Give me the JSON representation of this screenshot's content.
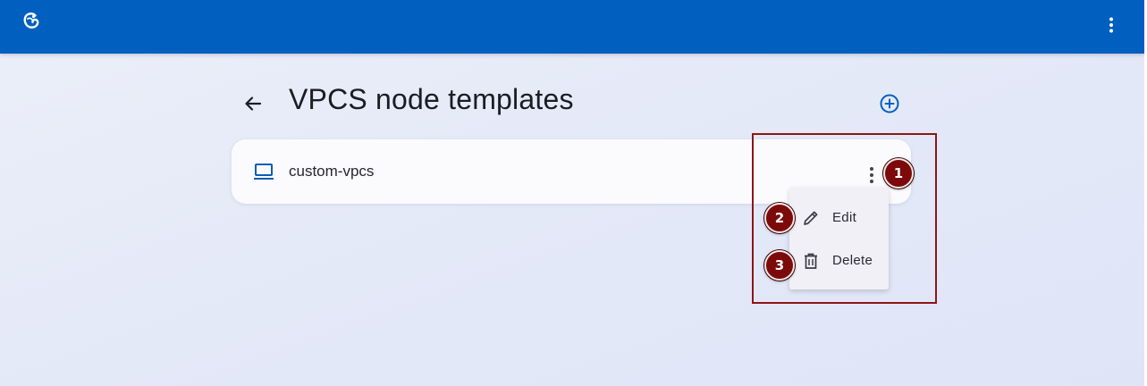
{
  "topbar": {
    "logo_icon": "gns3-logo-icon",
    "menu_icon": "more-vert-icon",
    "color": "#005fbf"
  },
  "header": {
    "back_icon": "arrow-back-icon",
    "title": "VPCS node templates",
    "add_icon": "add-circle-icon"
  },
  "templates": [
    {
      "icon": "computer-icon",
      "name": "custom-vpcs",
      "menu_icon": "more-vert-icon"
    }
  ],
  "context_menu": {
    "items": [
      {
        "icon": "pencil-icon",
        "label": "Edit"
      },
      {
        "icon": "trash-icon",
        "label": "Delete"
      }
    ]
  },
  "annotations": {
    "markers": [
      "1",
      "2",
      "3"
    ],
    "color": "#7d0a0a"
  }
}
